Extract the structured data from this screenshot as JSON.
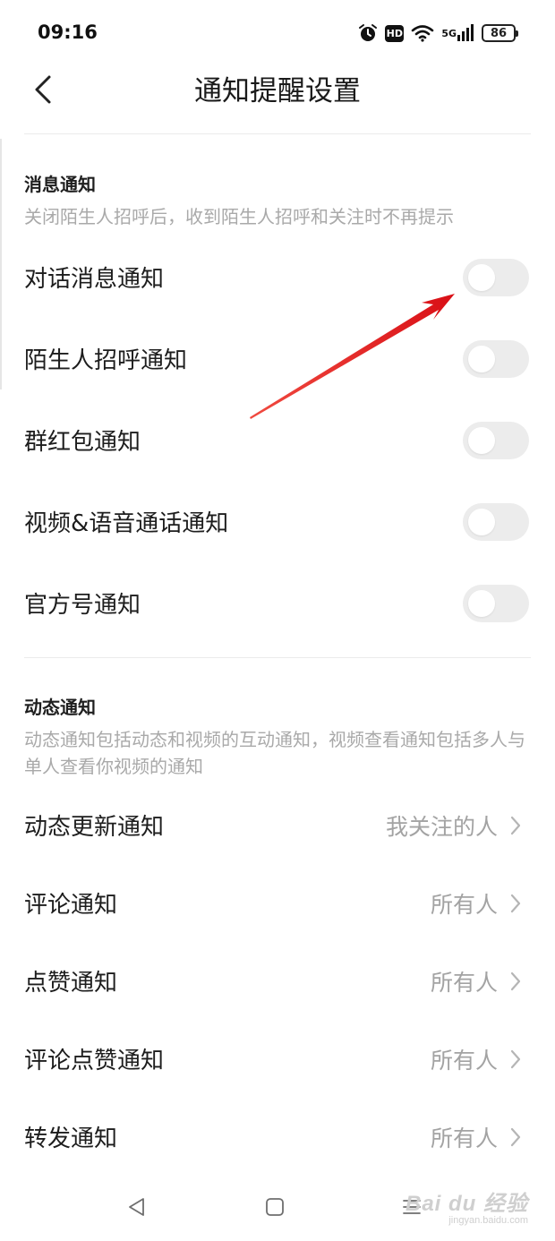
{
  "status_bar": {
    "time": "09:16",
    "icons": [
      "alarm-icon",
      "hd-icon",
      "wifi-icon",
      "5g-signal-icon",
      "battery-icon"
    ],
    "hd_label": "HD",
    "network_label": "5G",
    "battery_level": "86"
  },
  "header": {
    "back_icon": "chevron-left-icon",
    "title": "通知提醒设置"
  },
  "message_section": {
    "title": "消息通知",
    "description": "关闭陌生人招呼后，收到陌生人招呼和关注时不再提示",
    "items": [
      {
        "label": "对话消息通知",
        "enabled": false
      },
      {
        "label": "陌生人招呼通知",
        "enabled": false
      },
      {
        "label": "群红包通知",
        "enabled": false
      },
      {
        "label": "视频&语音通话通知",
        "enabled": false
      },
      {
        "label": "官方号通知",
        "enabled": false
      }
    ]
  },
  "dynamic_section": {
    "title": "动态通知",
    "description": "动态通知包括动态和视频的互动通知，视频查看通知包括多人与单人查看你视频的通知",
    "items": [
      {
        "label": "动态更新通知",
        "value": "我关注的人"
      },
      {
        "label": "评论通知",
        "value": "所有人"
      },
      {
        "label": "点赞通知",
        "value": "所有人"
      },
      {
        "label": "评论点赞通知",
        "value": "所有人"
      },
      {
        "label": "转发通知",
        "value": "所有人"
      }
    ]
  },
  "annotation": {
    "arrow_color": "#e8141a"
  },
  "nav_bar": {
    "buttons": [
      "back-triangle-icon",
      "home-square-icon",
      "menu-lines-icon"
    ]
  },
  "watermark": {
    "logo": "Bai du 经验",
    "url": "jingyan.baidu.com"
  }
}
